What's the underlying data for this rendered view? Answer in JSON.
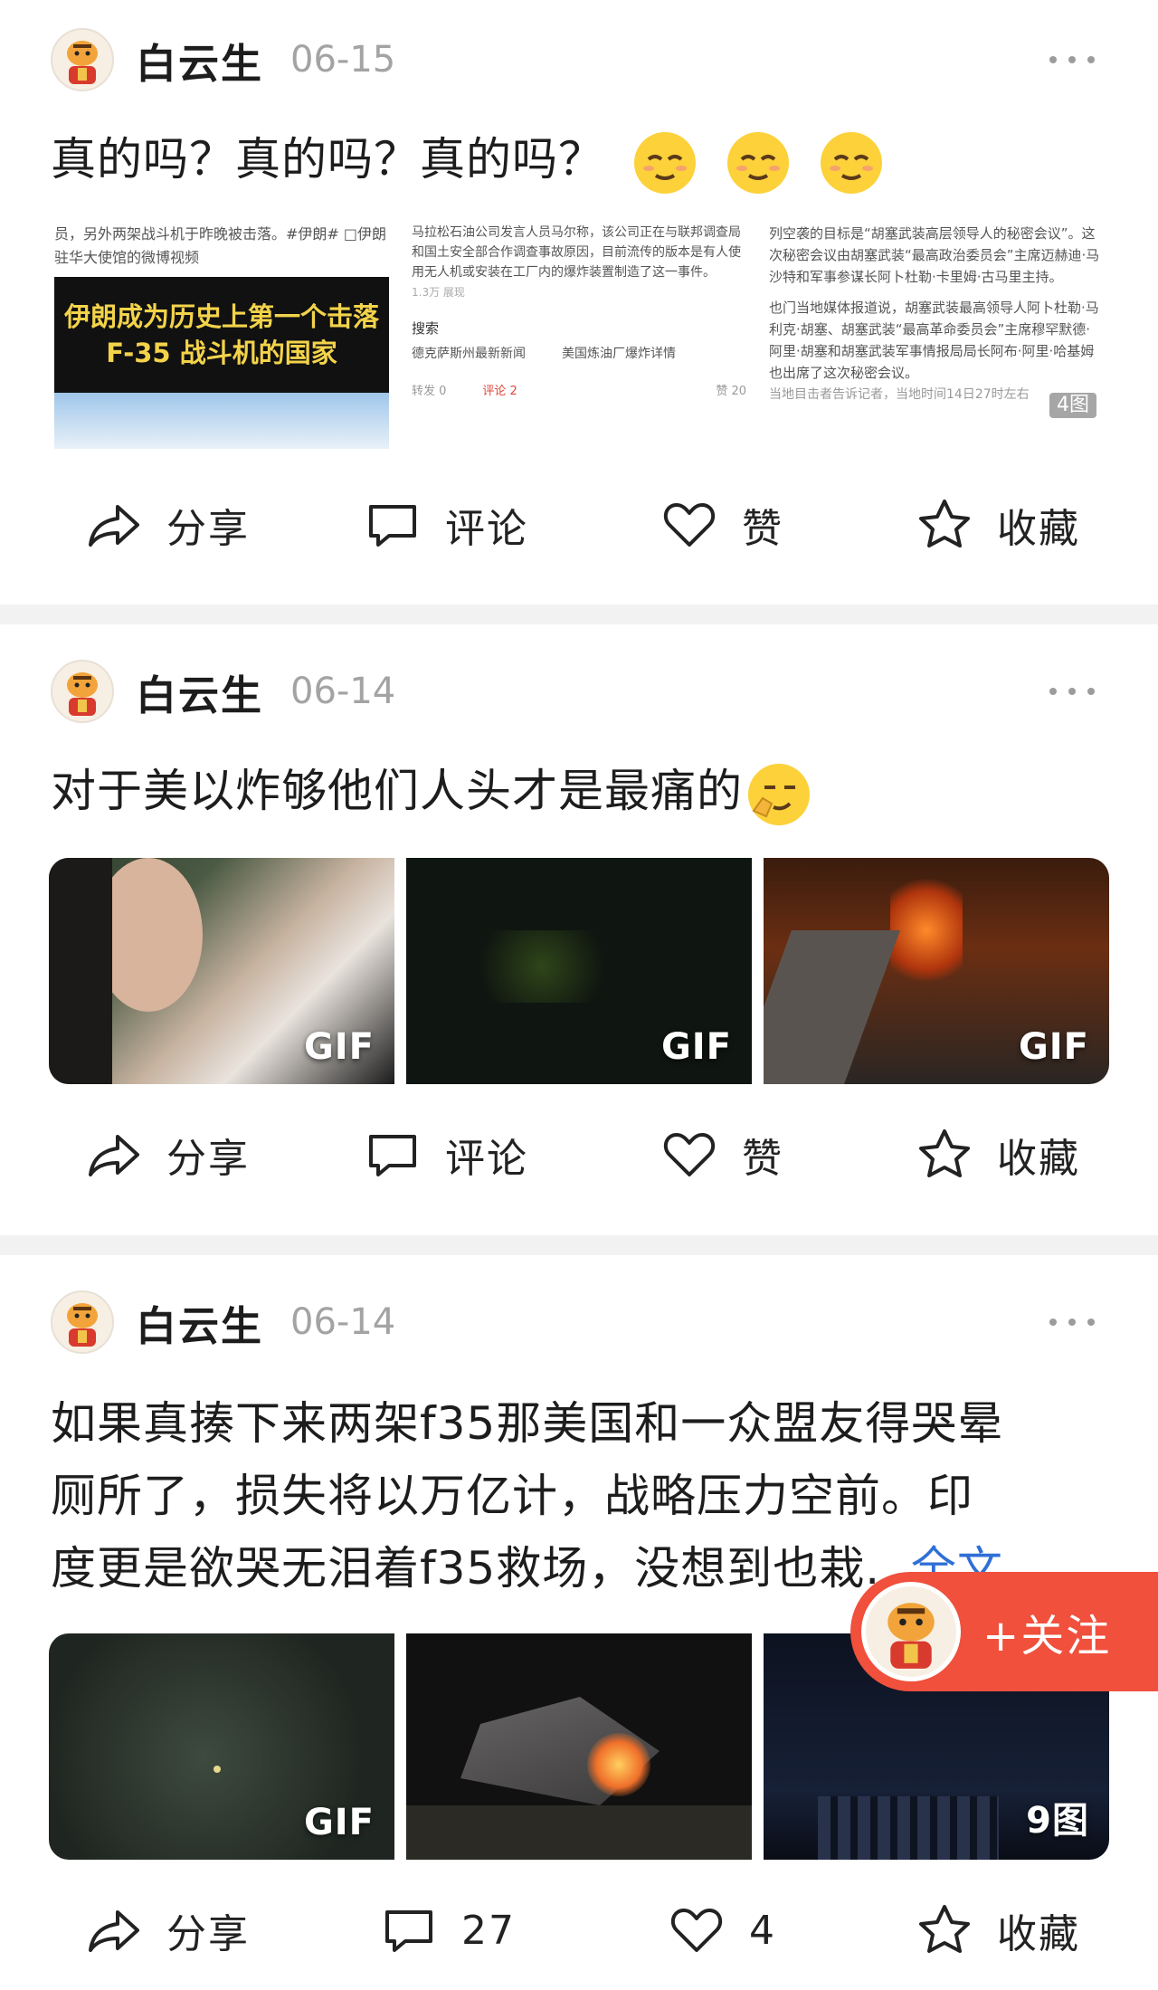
{
  "posts": [
    {
      "user": "白云生",
      "date": "06-15",
      "text": "真的吗？真的吗？真的吗？",
      "actions": {
        "share": "分享",
        "comment": "评论",
        "like": "赞",
        "fav": "收藏"
      },
      "screenshots": {
        "left_text": "员，另外两架战斗机于昨晚被击落。#伊朗# □伊朗驻华大使馆的微博视频",
        "left_banner": "伊朗成为历史上第一个击落 F-35 战斗机的国家",
        "mid_text": "马拉松石油公司发言人员马尔称，该公司正在与联邦调查局和国土安全部合作调查事故原因，目前流传的版本是有人使用无人机或安装在工厂内的爆炸装置制造了这一事件。",
        "mid_views": "1.3万 展现",
        "mid_search": "搜索",
        "mid_link1": "德克萨斯州最新新闻",
        "mid_link2": "美国炼油厂爆炸详情",
        "mid_forward": "转发 0",
        "mid_comment": "评论 2",
        "mid_like": "赞 20",
        "right_text1": "列空袭的目标是“胡塞武装高层领导人的秘密会议”。这次秘密会议由胡塞武装“最高政治委员会”主席迈赫迪·马沙特和军事参谋长阿卜杜勒·卡里姆·古马里主持。",
        "right_text2": "也门当地媒体报道说，胡塞武装最高领导人阿卜杜勒·马利克·胡塞、胡塞武装“最高革命委员会”主席穆罕默德·阿里·胡塞和胡塞武装军事情报局局长阿布·阿里·哈基姆也出席了这次秘密会议。",
        "right_badge": "4图",
        "right_tail": "当地目击者告诉记者，当地时间14日27时左右"
      }
    },
    {
      "user": "白云生",
      "date": "06-14",
      "text": "对于美以炸够他们人头才是最痛的",
      "actions": {
        "share": "分享",
        "comment": "评论",
        "like": "赞",
        "fav": "收藏"
      },
      "badges": [
        "GIF",
        "GIF",
        "GIF"
      ]
    },
    {
      "user": "白云生",
      "date": "06-14",
      "text_lines": [
        "如果真揍下来两架f35那美国和一众盟友得哭晕",
        "厕所了，损失将以万亿计，战略压力空前。印",
        "度更是欲哭无泪着f35救场，没想到也栽..."
      ],
      "full_text_link": "全文",
      "actions": {
        "share": "分享",
        "comment": "27",
        "like": "4",
        "fav": "收藏"
      },
      "badges": [
        "GIF",
        "",
        "9图"
      ]
    }
  ],
  "follow_button": "+关注",
  "colors": {
    "accent": "#f0503c",
    "link": "#2f6fd6",
    "separator": "#f2f2f2"
  }
}
